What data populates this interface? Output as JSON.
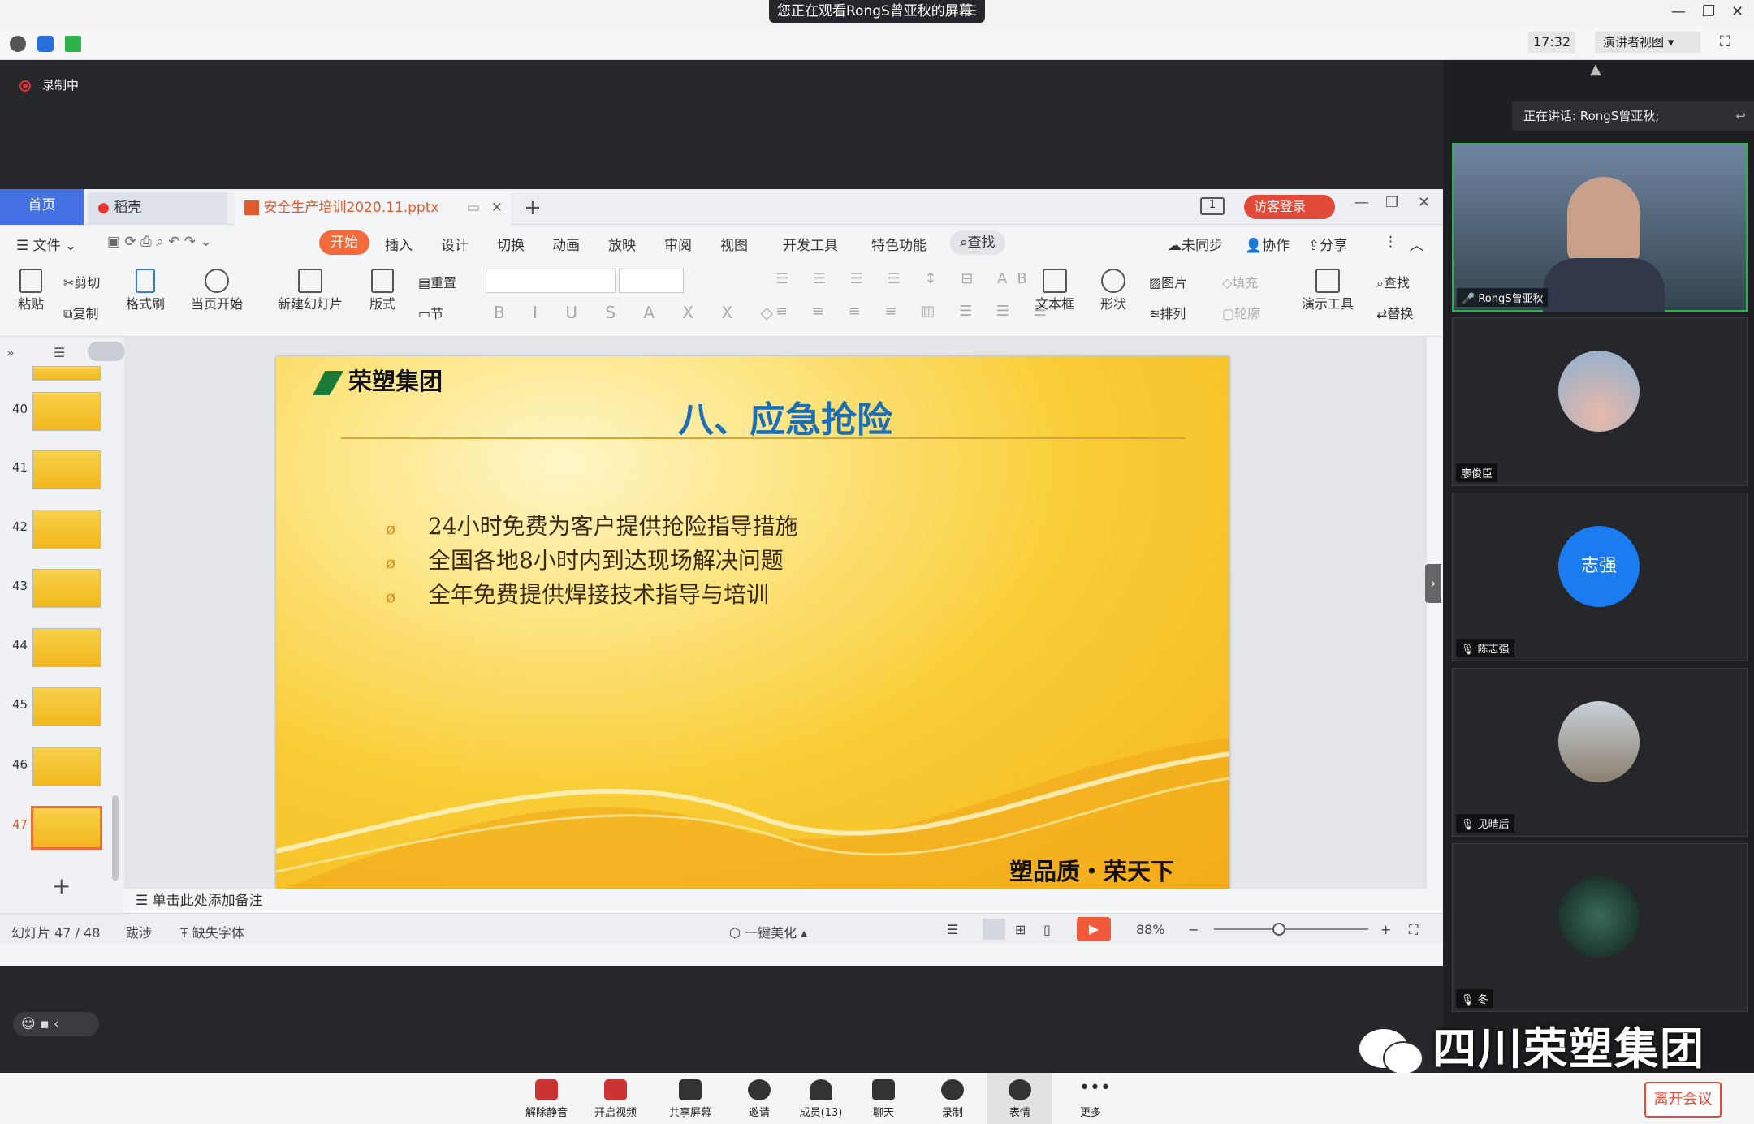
{
  "top": {
    "banner": "您正在观看RongS曾亚秋的屏幕",
    "clock": "17:32",
    "view_mode": "演讲者视图"
  },
  "recording": "录制中",
  "wps": {
    "tabs": {
      "home": "首页",
      "daoke": "稻壳",
      "file": "安全生产培训2020.11.pptx",
      "visitor": "访客登录"
    },
    "ribbon_tabs": [
      "文件",
      "开始",
      "插入",
      "设计",
      "切换",
      "动画",
      "放映",
      "审阅",
      "视图",
      "开发工具",
      "特色功能",
      "查找"
    ],
    "ribbon_right": {
      "sync": "未同步",
      "collab": "协作",
      "share": "分享"
    },
    "ribbon": {
      "paste": "粘贴",
      "cut": "剪切",
      "copy": "复制",
      "format_painter": "格式刷",
      "from_current": "当页开始",
      "new_slide": "新建幻灯片",
      "layout": "版式",
      "reset": "重置",
      "section": "节",
      "textbox": "文本框",
      "shape": "形状",
      "picture": "图片",
      "arrange": "排列",
      "fill": "填充",
      "outline": "轮廓",
      "present_tools": "演示工具",
      "find": "查找",
      "replace": "替换"
    },
    "thumbnails": [
      {
        "num": "40"
      },
      {
        "num": "41"
      },
      {
        "num": "42"
      },
      {
        "num": "43"
      },
      {
        "num": "44"
      },
      {
        "num": "45"
      },
      {
        "num": "46"
      },
      {
        "num": "47"
      }
    ],
    "slide": {
      "logo": "荣塑集团",
      "title": "八、应急抢险",
      "bullets": [
        "24小时免费为客户提供抢险指导措施",
        "全国各地8小时内到达现场解决问题",
        "全年免费提供焊接技术指导与培训"
      ],
      "footer": "塑品质・荣天下"
    },
    "notes_placeholder": "单击此处添加备注",
    "status": {
      "slide_counter": "幻灯片 47 / 48",
      "theme": "跋涉",
      "missing_font": "缺失字体",
      "beautify": "一键美化",
      "zoom": "88%"
    }
  },
  "meeting": {
    "speaking": "正在讲话: RongS曾亚秋;",
    "participants": [
      {
        "name": "RongS曾亚秋",
        "avatar_text": ""
      },
      {
        "name": "廖俊臣",
        "avatar_text": ""
      },
      {
        "name": "陈志强",
        "avatar_text": "志强"
      },
      {
        "name": "见晴后",
        "avatar_text": ""
      },
      {
        "name": "冬",
        "avatar_text": ""
      }
    ],
    "toolbar": [
      "解除静音",
      "开启视频",
      "共享屏幕",
      "邀请",
      "成员(13)",
      "聊天",
      "录制",
      "表情",
      "更多"
    ],
    "leave": "离开会议",
    "watermark": "四川荣塑集团"
  }
}
